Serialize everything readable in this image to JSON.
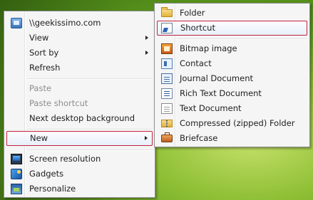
{
  "context_menu": {
    "items": [
      {
        "label": "\\\\geekissimo.com",
        "icon": "network-drive-icon"
      },
      {
        "label": "View",
        "submenu": true
      },
      {
        "label": "Sort by",
        "submenu": true
      },
      {
        "label": "Refresh"
      },
      {
        "label": "Paste",
        "disabled": true
      },
      {
        "label": "Paste shortcut",
        "disabled": true
      },
      {
        "label": "Next desktop background"
      },
      {
        "label": "New",
        "submenu": true,
        "highlighted": true
      },
      {
        "label": "Screen resolution",
        "icon": "screen-resolution-icon"
      },
      {
        "label": "Gadgets",
        "icon": "gadgets-icon"
      },
      {
        "label": "Personalize",
        "icon": "personalize-icon"
      }
    ]
  },
  "new_submenu": {
    "items": [
      {
        "label": "Folder",
        "icon": "folder-icon"
      },
      {
        "label": "Shortcut",
        "icon": "shortcut-icon",
        "highlighted": true
      },
      {
        "label": "Bitmap image",
        "icon": "bitmap-image-icon"
      },
      {
        "label": "Contact",
        "icon": "contact-icon"
      },
      {
        "label": "Journal Document",
        "icon": "journal-document-icon"
      },
      {
        "label": "Rich Text Document",
        "icon": "rich-text-document-icon"
      },
      {
        "label": "Text Document",
        "icon": "text-document-icon"
      },
      {
        "label": "Compressed (zipped) Folder",
        "icon": "zip-folder-icon"
      },
      {
        "label": "Briefcase",
        "icon": "briefcase-icon"
      }
    ]
  },
  "colors": {
    "highlight_border": "#c2223a",
    "menu_background": "#f5f5f5",
    "disabled_text": "#8d8d8d",
    "desktop_green": "#8fc036"
  }
}
